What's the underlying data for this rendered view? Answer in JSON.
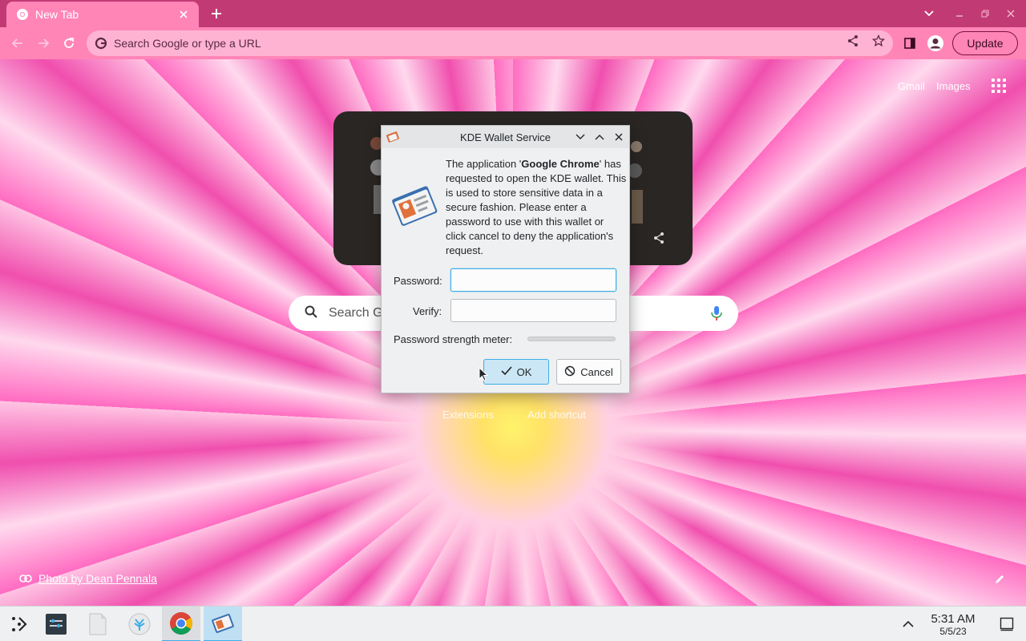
{
  "browser": {
    "tab": {
      "title": "New Tab",
      "favicon": "chrome-icon"
    },
    "omnibox": {
      "placeholder": "Search Google or type a URL"
    },
    "update_label": "Update"
  },
  "ntp": {
    "top_links": [
      "Gmail",
      "Images"
    ],
    "search_placeholder": "Search G",
    "shortcuts": [
      "Extensions",
      "Add shortcut"
    ],
    "photo_credit": "Photo by Dean Pennala"
  },
  "dialog": {
    "title": "KDE Wallet Service",
    "message_before": "The application '",
    "app_name": "Google Chrome",
    "message_after": "' has requested to open the KDE wallet. This is used to store sensitive data in a secure fashion. Please enter a password to use with this wallet or click cancel to deny the application's request.",
    "password_label": "Password:",
    "password_value": "",
    "verify_label": "Verify:",
    "verify_value": "",
    "strength_label": "Password strength meter:",
    "strength_level": 0,
    "ok_label": "OK",
    "cancel_label": "Cancel"
  },
  "taskbar": {
    "items": [
      "application-launcher-icon",
      "pager-icon",
      "file-icon",
      "discover-icon",
      "chrome-icon",
      "kwallet-icon"
    ],
    "time": "5:31 AM",
    "date": "5/5/23"
  },
  "colors": {
    "tabstrip": "#c23a74",
    "toolbar": "#ff85b7",
    "omnibox": "#ffb3d3",
    "kde_accent": "#3daee9",
    "dialog_bg": "#eff0f1"
  }
}
